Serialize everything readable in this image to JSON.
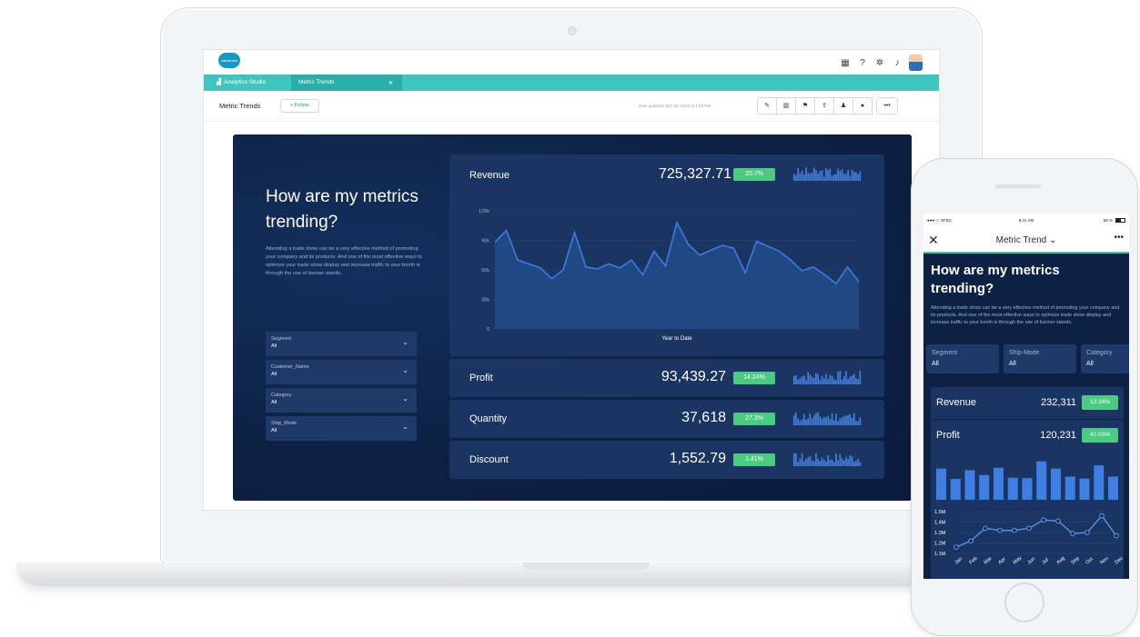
{
  "topbar": {
    "logo_text": "salesforce"
  },
  "tabs": [
    {
      "label": "Analytics Studio"
    },
    {
      "label": "Metric Trends",
      "close": "×"
    }
  ],
  "subheader": {
    "title": "Metric Trends",
    "follow_label": "+ Follow",
    "date_updated": "Date updated: Mar 28, 2018 at 1:53 PM",
    "more_label": "•••"
  },
  "dashboard": {
    "headline": "How are my metrics trending?",
    "description": "Attending a trade show can be a very effective method of promoting your company and its products. And one of the most effective ways to optimize your trade show display and increase traffic to your booth is through the use of banner stands.",
    "filters": [
      {
        "label": "Segment",
        "value": "All"
      },
      {
        "label": "Customer_Name",
        "value": "All"
      },
      {
        "label": "Category",
        "value": "All"
      },
      {
        "label": "Ship_Mode",
        "value": "All"
      }
    ],
    "metrics": [
      {
        "label": "Revenue",
        "value": "725,327.71",
        "badge": "20.7%"
      },
      {
        "label": "Profit",
        "value": "93,439.27",
        "badge": "14.24%"
      },
      {
        "label": "Quantity",
        "value": "37,618",
        "badge": "27.3%"
      },
      {
        "label": "Discount",
        "value": "1,552.79",
        "badge": "1.41%"
      }
    ]
  },
  "chart_data": [
    {
      "type": "area",
      "xlabel": "Year to Date",
      "ylabel": "",
      "ylim": [
        0,
        120000
      ],
      "yticks": [
        "0",
        "30k",
        "60k",
        "90k",
        "120k"
      ],
      "grid": true,
      "values": [
        88000,
        100000,
        70000,
        66000,
        62000,
        51000,
        60000,
        98000,
        63000,
        61000,
        66000,
        62000,
        70000,
        55000,
        79000,
        64000,
        108000,
        86000,
        75000,
        80000,
        85000,
        82000,
        57000,
        89000,
        84000,
        79000,
        70000,
        59000,
        63000,
        55000,
        46000,
        63000,
        48000
      ]
    },
    {
      "type": "bar",
      "values": [
        78,
        52,
        74,
        62,
        80,
        55,
        54,
        96,
        78,
        58,
        53,
        86,
        58
      ]
    },
    {
      "type": "line",
      "categories": [
        "Jan",
        "Feb",
        "Mar",
        "Apr",
        "May",
        "Jun",
        "Jul",
        "Aug",
        "Sep",
        "Oct",
        "Nov",
        "Dec"
      ],
      "ylim": [
        1100000,
        1500000
      ],
      "yticks": [
        "1.1M",
        "1.2M",
        "1.3M",
        "1.4M",
        "1.5M"
      ],
      "values": [
        1160000,
        1220000,
        1340000,
        1320000,
        1320000,
        1340000,
        1420000,
        1410000,
        1290000,
        1300000,
        1460000,
        1270000
      ]
    }
  ],
  "phone": {
    "status_left": "●●●○○ SFDC",
    "status_time": "9:41 AM",
    "status_right": "58 %",
    "nav_close": "✕",
    "nav_title": "Metric Trend",
    "nav_more": "•••",
    "headline": "How are my metrics trending?",
    "description": "Attending a trade show can be a very effective method of promoting your company and its products. And one of the most effective ways to optimize trade show display and increase traffic to your booth is through the use of banner stands.",
    "filters": [
      {
        "label": "Segment",
        "value": "All"
      },
      {
        "label": "Ship Mode",
        "value": "All"
      },
      {
        "label": "Category",
        "value": "All"
      }
    ],
    "metrics": [
      {
        "label": "Revenue",
        "value": "232,311",
        "badge": "12.34%"
      },
      {
        "label": "Profit",
        "value": "120,231",
        "badge": "42.03%"
      }
    ]
  },
  "colors": {
    "accent": "#3fc5c0",
    "badge": "#4bca81",
    "dash_bg": "#0d2145",
    "card_bg": "#1b3563",
    "chart_blue": "#3d7be0"
  }
}
